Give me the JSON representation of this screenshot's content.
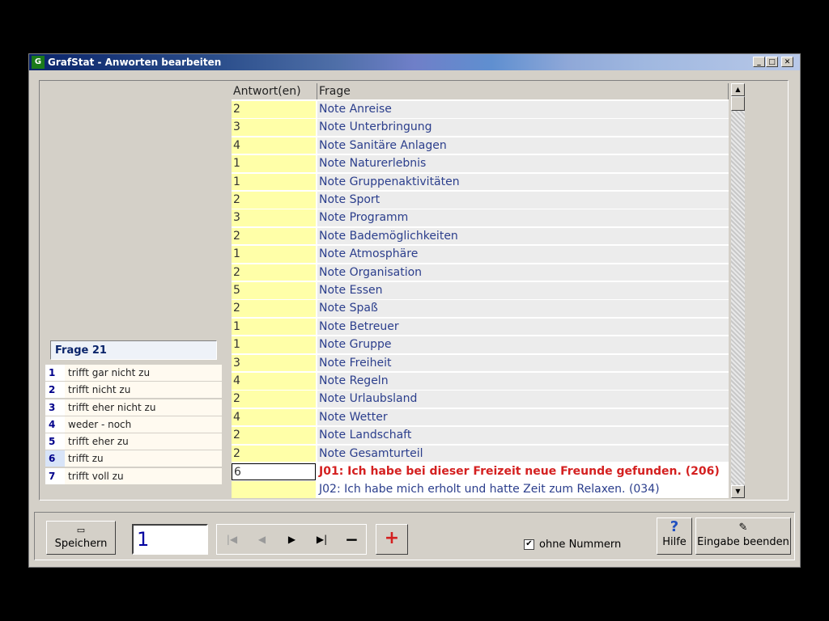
{
  "window": {
    "title": "GrafStat - Anworten bearbeiten",
    "controls": {
      "minimize": "_",
      "maximize": "□",
      "close": "✕"
    }
  },
  "left_panel": {
    "frage_title": "Frage 21",
    "options": [
      {
        "num": "1",
        "label": "trifft gar nicht zu"
      },
      {
        "num": "2",
        "label": "trifft nicht zu"
      },
      {
        "num": "3",
        "label": "trifft eher nicht zu"
      },
      {
        "num": "4",
        "label": "weder - noch"
      },
      {
        "num": "5",
        "label": "trifft eher zu"
      },
      {
        "num": "6",
        "label": "trifft zu",
        "selected": true
      },
      {
        "num": "7",
        "label": "trifft voll zu"
      }
    ]
  },
  "grid": {
    "headers": {
      "answer": "Antwort(en)",
      "question": "Frage"
    },
    "rows": [
      {
        "answer": "2",
        "question": "Note Anreise"
      },
      {
        "answer": "3",
        "question": "Note Unterbringung"
      },
      {
        "answer": "4",
        "question": "Note Sanitäre Anlagen"
      },
      {
        "answer": "1",
        "question": "Note Naturerlebnis"
      },
      {
        "answer": "1",
        "question": "Note Gruppenaktivitäten"
      },
      {
        "answer": "2",
        "question": "Note Sport"
      },
      {
        "answer": "3",
        "question": "Note Programm"
      },
      {
        "answer": "2",
        "question": "Note Bademöglichkeiten"
      },
      {
        "answer": "1",
        "question": "Note Atmosphäre"
      },
      {
        "answer": "2",
        "question": "Note Organisation"
      },
      {
        "answer": "5",
        "question": "Note Essen"
      },
      {
        "answer": "2",
        "question": "Note Spaß"
      },
      {
        "answer": "1",
        "question": "Note Betreuer"
      },
      {
        "answer": "1",
        "question": "Note Gruppe"
      },
      {
        "answer": "3",
        "question": "Note Freiheit"
      },
      {
        "answer": "4",
        "question": "Note Regeln"
      },
      {
        "answer": "2",
        "question": "Note Urlaubsland"
      },
      {
        "answer": "4",
        "question": "Note Wetter"
      },
      {
        "answer": "2",
        "question": "Note Landschaft"
      },
      {
        "answer": "2",
        "question": "Note Gesamturteil"
      },
      {
        "answer": "6",
        "question": "J01: Ich habe bei dieser Freizeit neue Freunde gefunden. (206)",
        "active": true
      },
      {
        "answer": "",
        "question": "J02: Ich habe mich erholt und hatte Zeit zum Relaxen. (034)"
      }
    ]
  },
  "toolbar": {
    "save_label": "Speichern",
    "record_number": "1",
    "nav": {
      "first": "|◀",
      "prev": "◀",
      "next": "▶",
      "last": "▶|",
      "delete": "−",
      "add": "+"
    },
    "checkbox_label": "ohne Nummern",
    "checkbox_checked": true,
    "help_label": "Hilfe",
    "finish_label": "Eingabe beenden"
  },
  "colors": {
    "answer_bg": "#ffffa8",
    "question_text": "#2b3e8c",
    "active_question": "#d42020",
    "add_button": "#d42020"
  },
  "icons": [
    "app-icon",
    "scroll-up-icon",
    "scroll-down-icon",
    "save-icon",
    "help-icon",
    "finish-icon",
    "checkbox-icon"
  ]
}
